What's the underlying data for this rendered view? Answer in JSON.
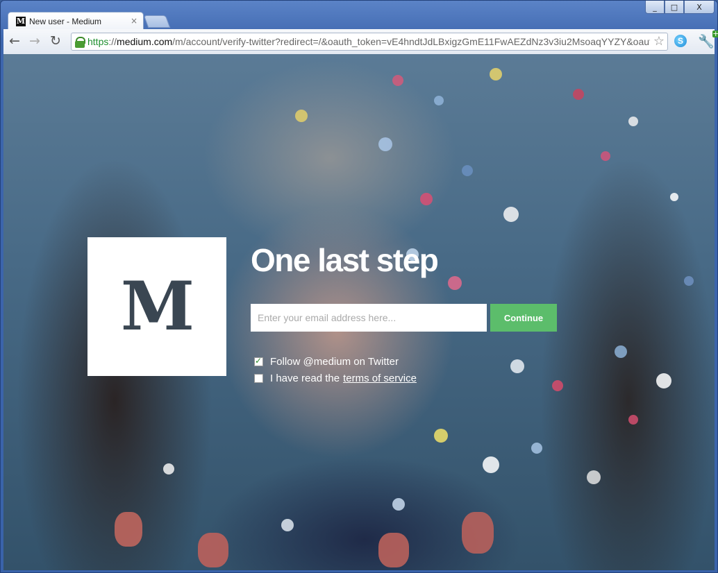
{
  "browser": {
    "tab_title": "New user - Medium",
    "tab_favicon_letter": "M",
    "url_scheme": "https",
    "url_host": "medium.com",
    "url_path": "/m/account/verify-twitter?redirect=/&oauth_token=vE4hndtJdLBxigzGmE11FwAEZdNz3v3iu2MsoaqYYZY&oaut",
    "window_controls": {
      "minimize": "_",
      "maximize": "□",
      "close": "X"
    }
  },
  "page": {
    "logo_letter": "M",
    "heading": "One last step",
    "email_placeholder": "Enter your email address here...",
    "email_value": "",
    "continue_label": "Continue",
    "follow_label": "Follow @medium on Twitter",
    "follow_checked": true,
    "terms_prefix": "I have read the",
    "terms_link": "terms of service",
    "terms_checked": false
  },
  "colors": {
    "continue_button": "#5cbd6b",
    "https_green": "#1e8f2e"
  }
}
